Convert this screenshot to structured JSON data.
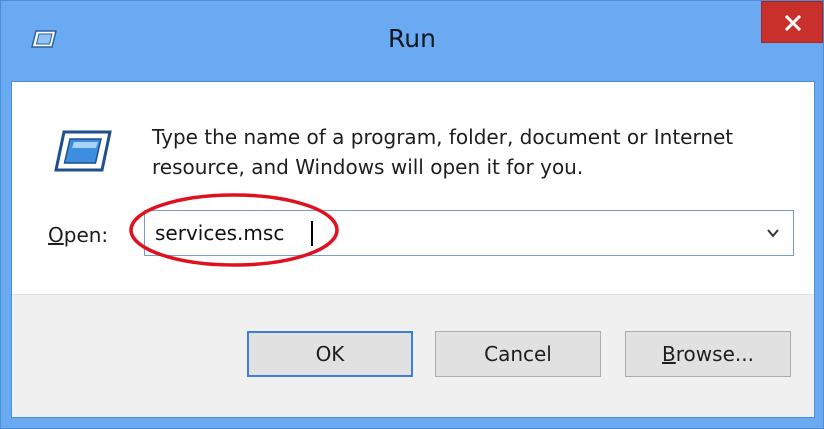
{
  "window": {
    "title": "Run",
    "close_symbol": "✕"
  },
  "dialog": {
    "description": "Type the name of a program, folder, document or Internet resource, and Windows will open it for you.",
    "open_label_accel": "O",
    "open_label_rest": "pen:",
    "open_value": "services.msc"
  },
  "buttons": {
    "ok": "OK",
    "cancel": "Cancel",
    "browse_accel": "B",
    "browse_rest": "rowse..."
  },
  "icons": {
    "title": "run-icon",
    "main": "run-icon",
    "dropdown": "chevron-down-icon",
    "close": "close-icon"
  },
  "colors": {
    "titlebar": "#6aaaf2",
    "close": "#c9302c",
    "annotation": "#e0101e",
    "default_button_border": "#3c7fd8"
  }
}
